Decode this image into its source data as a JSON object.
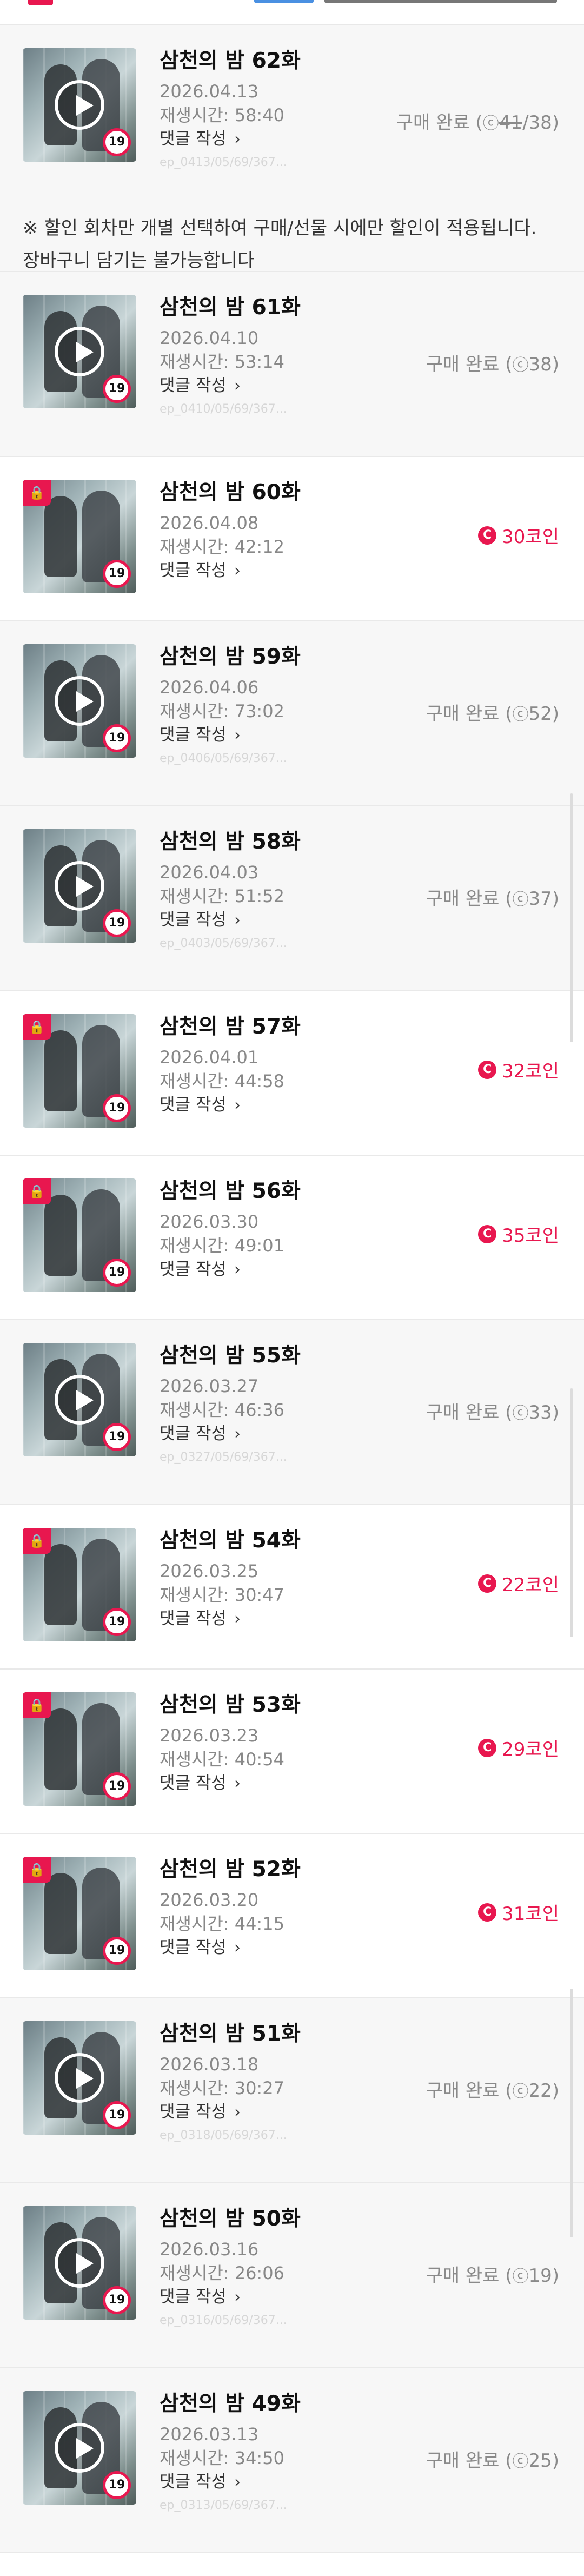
{
  "episodes": [
    {
      "title": "삼천의 밤 62화",
      "date": "2026.04.13",
      "runtime": "재생시간: 58:40",
      "comment": "댓글 작성",
      "status_label": "구매 완료 (",
      "status_icon": "ⓒ",
      "status_old": "41",
      "status_price": "/38)",
      "faint": "ep_0413/05/69/367..."
    },
    {
      "title": "삼천의 밤 61화",
      "date": "2026.04.10",
      "runtime": "재생시간: 53:14",
      "comment": "댓글 작성",
      "status_label": "구매 완료 (",
      "status_icon": "ⓒ",
      "status_price": "38)",
      "faint": "ep_0410/05/69/367..."
    },
    {
      "title": "삼천의 밤 60화",
      "date": "2026.04.08",
      "runtime": "재생시간: 42:12",
      "comment": "댓글 작성",
      "price": "30코인"
    },
    {
      "title": "삼천의 밤 59화",
      "date": "2026.04.06",
      "runtime": "재생시간: 73:02",
      "comment": "댓글 작성",
      "status_label": "구매 완료 (",
      "status_icon": "ⓒ",
      "status_price": "52)",
      "faint": "ep_0406/05/69/367..."
    },
    {
      "title": "삼천의 밤 58화",
      "date": "2026.04.03",
      "runtime": "재생시간: 51:52",
      "comment": "댓글 작성",
      "status_label": "구매 완료 (",
      "status_icon": "ⓒ",
      "status_price": "37)",
      "faint": "ep_0403/05/69/367..."
    },
    {
      "title": "삼천의 밤 57화",
      "date": "2026.04.01",
      "runtime": "재생시간: 44:58",
      "comment": "댓글 작성",
      "price": "32코인"
    },
    {
      "title": "삼천의 밤 56화",
      "date": "2026.03.30",
      "runtime": "재생시간: 49:01",
      "comment": "댓글 작성",
      "price": "35코인"
    },
    {
      "title": "삼천의 밤 55화",
      "date": "2026.03.27",
      "runtime": "재생시간: 46:36",
      "comment": "댓글 작성",
      "status_label": "구매 완료 (",
      "status_icon": "ⓒ",
      "status_price": "33)",
      "faint": "ep_0327/05/69/367..."
    },
    {
      "title": "삼천의 밤 54화",
      "date": "2026.03.25",
      "runtime": "재생시간: 30:47",
      "comment": "댓글 작성",
      "price": "22코인"
    },
    {
      "title": "삼천의 밤 53화",
      "date": "2026.03.23",
      "runtime": "재생시간: 40:54",
      "comment": "댓글 작성",
      "price": "29코인"
    },
    {
      "title": "삼천의 밤 52화",
      "date": "2026.03.20",
      "runtime": "재생시간: 44:15",
      "comment": "댓글 작성",
      "price": "31코인"
    },
    {
      "title": "삼천의 밤 51화",
      "date": "2026.03.18",
      "runtime": "재생시간: 30:27",
      "comment": "댓글 작성",
      "status_label": "구매 완료 (",
      "status_icon": "ⓒ",
      "status_price": "22)",
      "faint": "ep_0318/05/69/367..."
    },
    {
      "title": "삼천의 밤 50화",
      "date": "2026.03.16",
      "runtime": "재생시간: 26:06",
      "comment": "댓글 작성",
      "status_label": "구매 완료 (",
      "status_icon": "ⓒ",
      "status_price": "19)",
      "faint": "ep_0316/05/69/367..."
    },
    {
      "title": "삼천의 밤 49화",
      "date": "2026.03.13",
      "runtime": "재생시간: 34:50",
      "comment": "댓글 작성",
      "status_label": "구매 완료 (",
      "status_icon": "ⓒ",
      "status_price": "25)",
      "faint": "ep_0313/05/69/367..."
    }
  ],
  "notice": "※ 할인 회차만 개별 선택하여 구매/선물 시에만 할인이 적용됩니다. 장바구니 담기는 불가능합니다",
  "badges": {
    "age": "19",
    "coin": "C",
    "lock": "🔒",
    "chevron": "›"
  },
  "colors": {
    "accent": "#e8174f",
    "muted": "#8a8a8a",
    "purchased_bg": "#f7f7f7"
  },
  "icons": {
    "play": "play-icon",
    "lock": "lock-icon",
    "age": "age-19-badge",
    "coin": "coin-icon"
  }
}
